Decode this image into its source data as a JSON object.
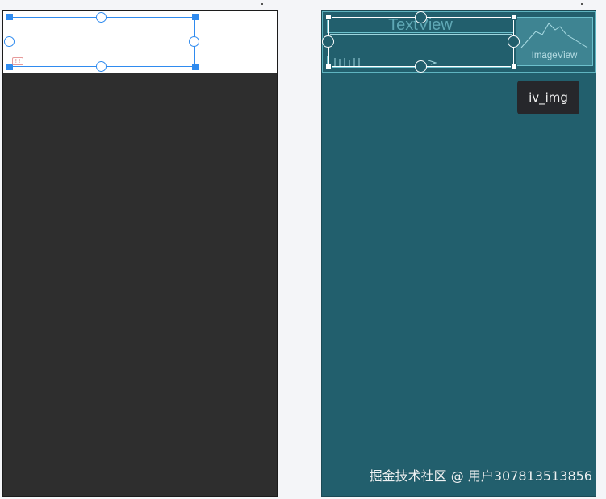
{
  "blueprint": {
    "text_view_label": "TextView",
    "image_view_label": "ImageView",
    "tooltip": "iv_img"
  },
  "watermark": "掘金技术社区 @ 用户307813513856",
  "colors": {
    "selection_blue": "#2f8bef",
    "design_background": "#2e2e2e",
    "blueprint_background": "#225f6d",
    "blueprint_line": "#6cc0cc"
  },
  "icons": {
    "error_badge": "error-badge-icon",
    "image_placeholder": "mountain-icon"
  }
}
